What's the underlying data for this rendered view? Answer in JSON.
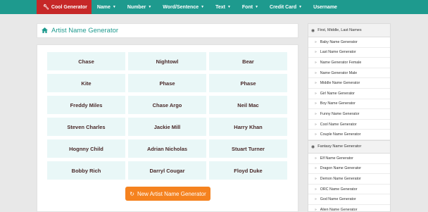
{
  "navbar": {
    "active": "Cool Generator",
    "items": [
      {
        "label": "Name",
        "caret": true
      },
      {
        "label": "Number",
        "caret": true
      },
      {
        "label": "Word/Sentence",
        "caret": true
      },
      {
        "label": "Text",
        "caret": true
      },
      {
        "label": "Font",
        "caret": true
      },
      {
        "label": "Credit Card",
        "caret": true
      },
      {
        "label": "Username",
        "caret": false
      }
    ]
  },
  "header": {
    "title": "Artist Name Generator"
  },
  "names": [
    "Chase",
    "Nightowl",
    "Bear",
    "Kite",
    "Phase",
    "Phase",
    "Freddy Miles",
    "Chase Argo",
    "Neil Mac",
    "Steven Charles",
    "Jackie Mill",
    "Harry Khan",
    "Hognny Child",
    "Adrian Nicholas",
    "Stuart Turner",
    "Bobby Rich",
    "Darryl Cougar",
    "Floyd Duke"
  ],
  "generate_button": {
    "label": "New Artist Name Generator"
  },
  "sidebar": {
    "section1": {
      "title": "First, Middle, Last Names",
      "items": [
        "Baby Name Generator",
        "Last Name Generator",
        "Name Generator Female",
        "Name Generator Male",
        "Middle Name Generator",
        "Girl Name Generator",
        "Boy Name Generator",
        "Funny Name Generator",
        "Cool Name Generator",
        "Couple Name Generator"
      ]
    },
    "section2": {
      "title": "Fantasy Name Generator",
      "items": [
        "Elf Name Generator",
        "Dragon Name Generator",
        "Demon Name Generator",
        "ORC Name Generator",
        "God Name Generator",
        "Alien Name Generator"
      ]
    }
  },
  "colors": {
    "teal": "#1e9a8e",
    "red": "#c62828",
    "orange": "#f5821f",
    "cell": "#e9f7f7"
  }
}
